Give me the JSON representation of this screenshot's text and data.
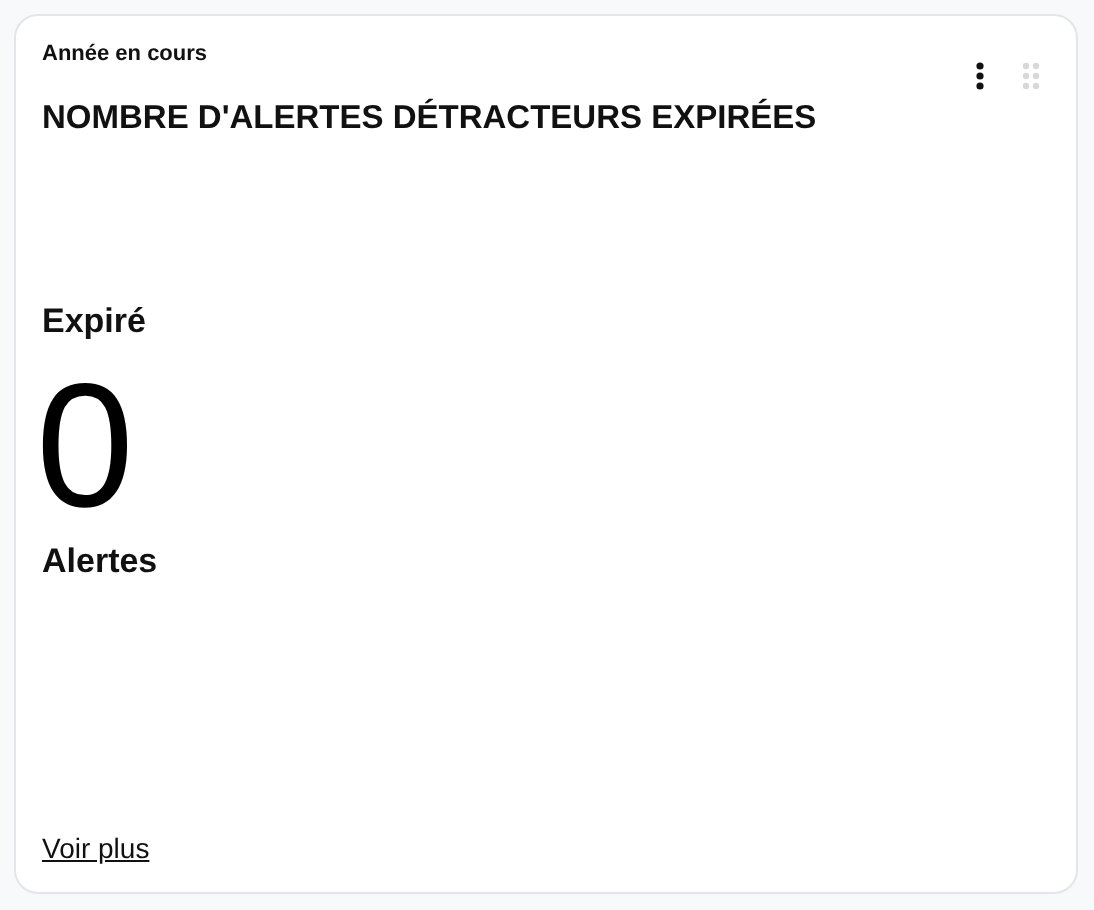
{
  "card": {
    "period": "Année en cours",
    "title": "NOMBRE D'ALERTES DÉTRACTEURS EXPIRÉES",
    "status_label": "Expiré",
    "value": "0",
    "unit": "Alertes",
    "link": "Voir plus"
  }
}
